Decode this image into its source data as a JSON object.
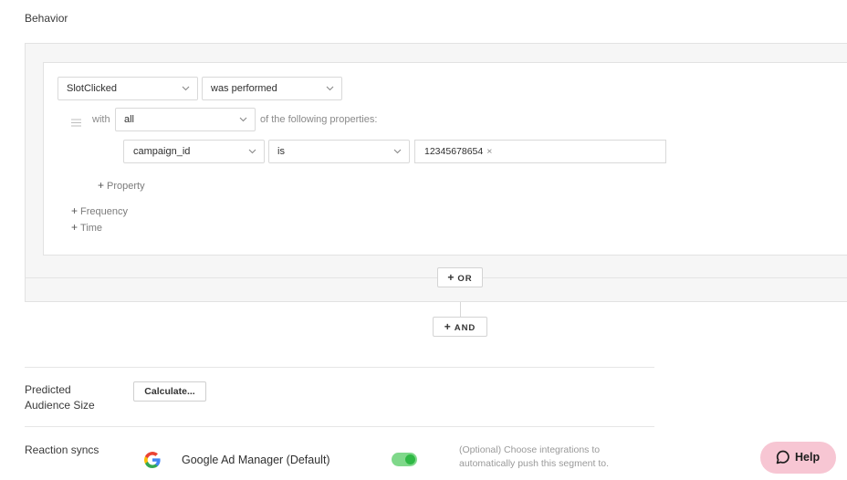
{
  "section_title": "Behavior",
  "event": {
    "value": "SlotClicked",
    "action": "was performed"
  },
  "filter": {
    "with_label": "with",
    "match": "all",
    "suffix": "of the following properties:",
    "property": "campaign_id",
    "operator": "is",
    "tags": [
      "12345678654"
    ],
    "tag_remove": "×"
  },
  "add_property": "Property",
  "add_frequency": "Frequency",
  "add_time": "Time",
  "or_button": "OR",
  "and_button": "AND",
  "plus_glyph": "+",
  "predicted": {
    "label_line1": "Predicted",
    "label_line2": "Audience Size",
    "button": "Calculate..."
  },
  "reaction_syncs": {
    "label": "Reaction syncs",
    "integration_name": "Google Ad Manager (Default)",
    "toggle_on": true,
    "hint_line1": "(Optional) Choose integrations to",
    "hint_line2": "automatically push this segment to."
  },
  "help_button": "Help",
  "colors": {
    "toggle": "#2fb845",
    "help_bg": "#f7c6d3",
    "panel_bg": "#f6f6f6"
  },
  "icons": [
    "hamburger-icon",
    "chevron-down-icon",
    "google-icon",
    "chat-bubble-icon"
  ]
}
